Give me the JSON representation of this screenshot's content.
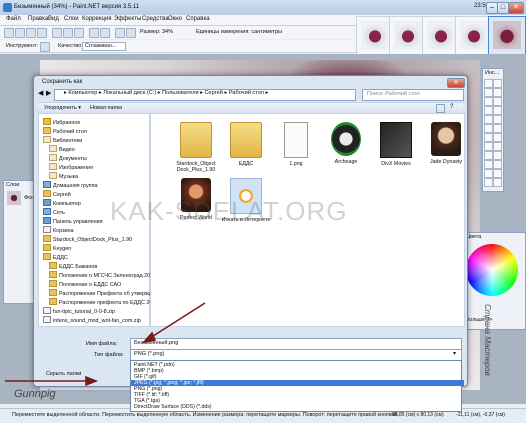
{
  "window": {
    "title": "Безымянный (34%) - Paint.NET версия 3.5.11",
    "clock": "23:50"
  },
  "menu": [
    "Файл",
    "Правка",
    "Вид",
    "Слои",
    "Коррекция",
    "Эффекты",
    "Средства",
    "Окно",
    "Справка"
  ],
  "toolbar": {
    "zoom_label": "Размер: 34%",
    "units_label": "Единицы измерения: сантиметры",
    "tool_label": "Инструмент:",
    "quality_label": "Качество:",
    "quality_value": "Сглаживан..."
  },
  "dialog": {
    "title": "Сохранить как",
    "address": "▸ Компьютер ▸ Локальный диск (C:) ▸ Пользователи ▸ Сергей ▸ Рабочий стол ▸",
    "search_placeholder": "Поиск: Рабочий стол",
    "organize": "Упорядочить ▾",
    "new_folder": "Новая папка",
    "nav": [
      {
        "label": "Избранное",
        "icon": "star"
      },
      {
        "label": "Рабочий стол",
        "icon": "folder"
      },
      {
        "label": "Библиотеки",
        "icon": "lib"
      },
      {
        "label": "Видео",
        "icon": "lib"
      },
      {
        "label": "Документы",
        "icon": "lib"
      },
      {
        "label": "Изображения",
        "icon": "lib"
      },
      {
        "label": "Музыка",
        "icon": "lib"
      },
      {
        "label": "Домашняя группа",
        "icon": "net"
      },
      {
        "label": "Сергей",
        "icon": "folder"
      },
      {
        "label": "Компьютер",
        "icon": "pc"
      },
      {
        "label": "Сеть",
        "icon": "net"
      },
      {
        "label": "Панель управления",
        "icon": "pc"
      },
      {
        "label": "Корзина",
        "icon": "file"
      },
      {
        "label": "Stardock_ObjectDock_Plus_1.90",
        "icon": "folder"
      },
      {
        "label": "Keygen",
        "icon": "folder"
      },
      {
        "label": "ЕДДС",
        "icon": "folder"
      },
      {
        "label": "ЕДДС Бажанов",
        "icon": "folder"
      },
      {
        "label": "Положение о МГСЧС Зеленоград 201",
        "icon": "folder"
      },
      {
        "label": "Положение о ЕДДС САО",
        "icon": "folder"
      },
      {
        "label": "Распоряжение Префекта об утвержд",
        "icon": "folder"
      },
      {
        "label": "Распоряжение префекта по ЕДДС 201",
        "icon": "folder"
      },
      {
        "label": "fun-tipic_tutorial_0-0-8.zip",
        "icon": "file"
      },
      {
        "label": "intens_sound_mod_wot-fan_com.zip",
        "icon": "file"
      }
    ],
    "files": [
      {
        "label": "Stardock_Object Dock_Plus_1.90",
        "kind": "folder"
      },
      {
        "label": "ЕДДС",
        "kind": "folder"
      },
      {
        "label": "1.png",
        "kind": "docpng"
      },
      {
        "label": "Archeage",
        "kind": "aich"
      },
      {
        "label": "DivX Movies",
        "kind": "divx"
      },
      {
        "label": "Jade Dynasty",
        "kind": "jade"
      },
      {
        "label": "Perfect World",
        "kind": "pw"
      },
      {
        "label": "Искать в Интернете",
        "kind": "ie"
      }
    ],
    "filename_label": "Имя файла:",
    "filename_value": "Безымянный.png",
    "filetype_label": "Тип файла:",
    "filetype_value": "PNG (*.png)",
    "hide_folders": "Скрыть папки",
    "filetype_options": [
      "Paint.NET (*.pdn)",
      "BMP (*.bmp)",
      "GIF (*.gif)",
      "JPEG (*.jpg; *.jpeg; *.jpe; *.jfif)",
      "PNG (*.png)",
      "TIFF (*.tif; *.tiff)",
      "TGA (*.tga)",
      "DirectDraw Surface (DDS) (*.dds)"
    ],
    "filetype_selected_index": 3
  },
  "panels": {
    "layers_title": "Слои",
    "layers_item": "Фон",
    "tools_title": "Инс...",
    "colors_title": "Цвета",
    "colors_more": "Больше >>"
  },
  "status": {
    "text": "Переместите выделенной области. Переместить выделенную область. Изменение размера: перетащите маркеры. Поворот: перетащите правой кнопкой.",
    "size": "80,85 (см) x 80,13 (см)",
    "pos": "-11,11 (см), -0,37 (см)"
  },
  "overlays": {
    "watermark": "KAK-SDELAT.ORG",
    "brand": "Gunnpig",
    "side_url": "Страна Мастеров"
  }
}
